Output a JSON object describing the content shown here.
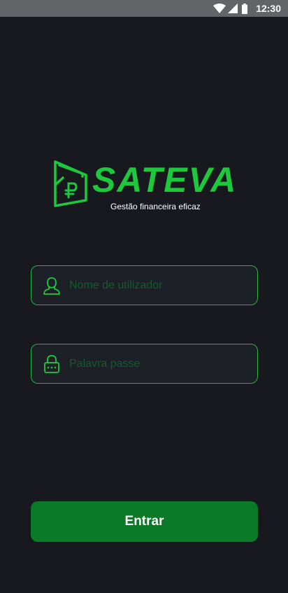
{
  "status_bar": {
    "time": "12:30",
    "icons": [
      "wifi-icon",
      "signal-icon",
      "battery-icon"
    ]
  },
  "brand": {
    "name": "SATEVA",
    "tagline": "Gestão financeira eficaz",
    "logo_icon": "wallet-ruble-icon",
    "accent_color": "#1ec83c"
  },
  "form": {
    "username": {
      "placeholder": "Nome de utilizador",
      "value": "",
      "icon": "user-icon"
    },
    "password": {
      "placeholder": "Palavra passe",
      "value": "",
      "icon": "lock-icon"
    },
    "submit_label": "Entrar"
  },
  "colors": {
    "background": "#17191f",
    "field_border": "#21b83c",
    "button": "#0a7a27"
  }
}
